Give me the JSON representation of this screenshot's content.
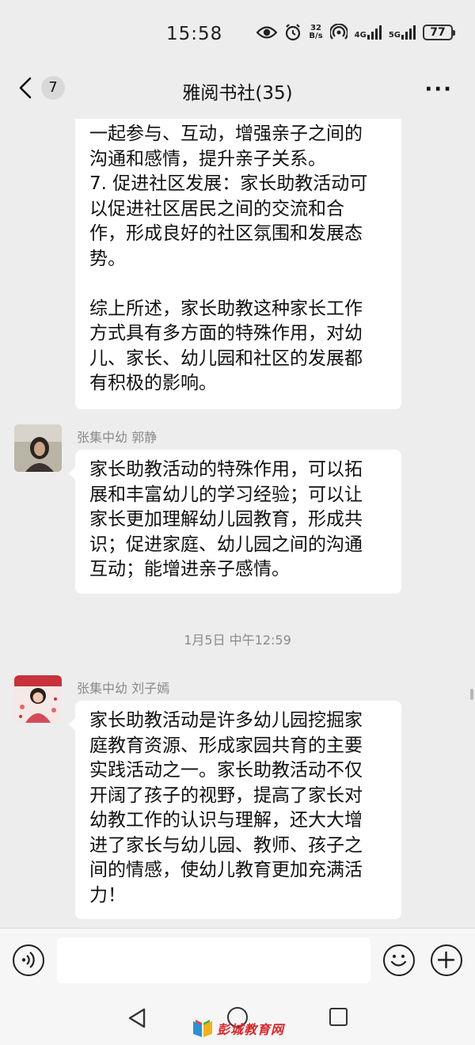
{
  "status_bar": {
    "time": "15:58",
    "net_speed_value": "32",
    "net_speed_unit": "B/s",
    "signal_1": "4G",
    "signal_2": "5G",
    "battery": "77"
  },
  "header": {
    "unread_count": "7",
    "title": "雅阅书社(35)",
    "more_label": "···"
  },
  "messages": [
    {
      "text": "一起参与、互动，增强亲子之间的\n沟通和感情，提升亲子关系。\n7. 促进社区发展：家长助教活动可\n以促进社区居民之间的交流和合\n作，形成良好的社区氛围和发展态\n势。\n\n综上所述，家长助教这种家长工作\n方式具有多方面的特殊作用，对幼\n儿、家长、幼儿园和社区的发展都\n有积极的影响。"
    },
    {
      "sender": "张集中幼 郭静",
      "text": "家长助教活动的特殊作用，可以拓\n展和丰富幼儿的学习经验；可以让\n家长更加理解幼儿园教育，形成共\n识；促进家庭、幼儿园之间的沟通\n互动；能增进亲子感情。"
    },
    {
      "sender": "张集中幼 刘子嫣",
      "text": "家长助教活动是许多幼儿园挖掘家\n庭教育资源、形成家园共育的主要\n实践活动之一。家长助教活动不仅\n开阔了孩子的视野，提高了家长对\n幼教工作的认识与理解，还大大增\n进了家长与幼儿园、教师、孩子之\n间的情感，使幼儿教育更加充满活\n力！"
    }
  ],
  "timestamp": "1月5日 中午12:59",
  "input": {
    "value": ""
  },
  "watermark": "彭城教育网"
}
